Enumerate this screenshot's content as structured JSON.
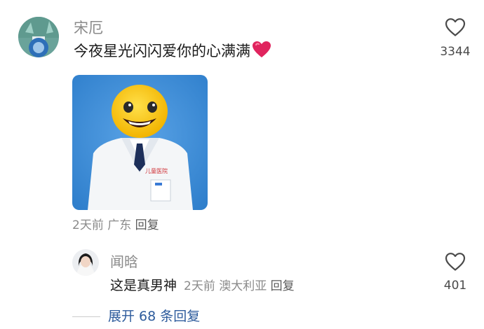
{
  "comment": {
    "username": "宋厄",
    "text": "今夜星光闪闪爱你的心满满",
    "emoji": "heart-emoji",
    "meta": {
      "time": "2天前",
      "location": "广东",
      "reply_label": "回复"
    },
    "likes": "3344"
  },
  "reply": {
    "username": "闻晗",
    "text": "这是真男神",
    "meta": {
      "time": "2天前",
      "location": "澳大利亚",
      "reply_label": "回复"
    },
    "likes": "401"
  },
  "expand": {
    "label": "展开 68 条回复"
  },
  "colors": {
    "username": "#8a8a8a",
    "link_blue": "#2d5b9c",
    "image_bg": "#3f8fd9",
    "heart": "#e0245e"
  }
}
